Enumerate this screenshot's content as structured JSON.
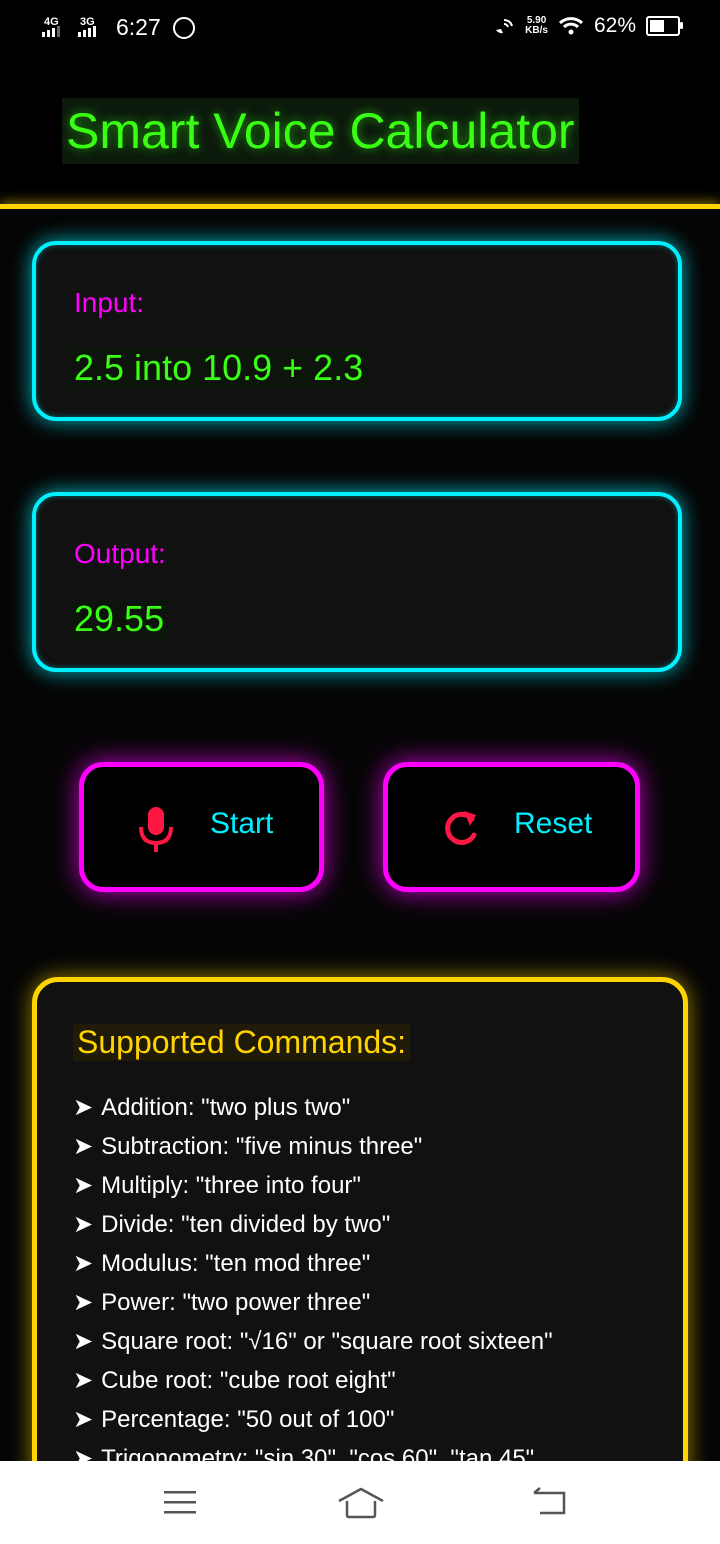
{
  "status": {
    "net1": "4G",
    "net2": "3G",
    "time": "6:27",
    "speed_value": "5.90",
    "speed_unit": "KB/s",
    "battery_text": "62%",
    "battery_level": 0.62
  },
  "app": {
    "title": "Smart Voice Calculator"
  },
  "input": {
    "label": "Input:",
    "value": "2.5 into 10.9 + 2.3"
  },
  "output": {
    "label": "Output:",
    "value": "29.55"
  },
  "buttons": {
    "start_label": "Start",
    "reset_label": "Reset"
  },
  "commands": {
    "heading": "Supported Commands:",
    "arrow": "➤",
    "items": [
      "Addition: \"two plus two\"",
      "Subtraction: \"five minus three\"",
      "Multiply: \"three into four\"",
      "Divide: \"ten divided by two\"",
      "Modulus: \"ten mod three\"",
      "Power: \"two power three\"",
      "Square root: \"√16\" or \"square root sixteen\"",
      "Cube root: \"cube root eight\"",
      "Percentage: \"50 out of 100\"",
      "Trigonometry: \"sin 30\", \"cos 60\", \"tan 45\""
    ]
  },
  "colors": {
    "title_green": "#39ff14",
    "label_magenta": "#ff00ff",
    "card_cyan": "#00f0ff",
    "accent_yellow": "#ffd400",
    "icon_red": "#ff1744"
  },
  "icons": {
    "start": "microphone-icon",
    "reset": "refresh-icon",
    "nav_menu": "menu-icon",
    "nav_home": "home-icon",
    "nav_back": "back-icon"
  }
}
